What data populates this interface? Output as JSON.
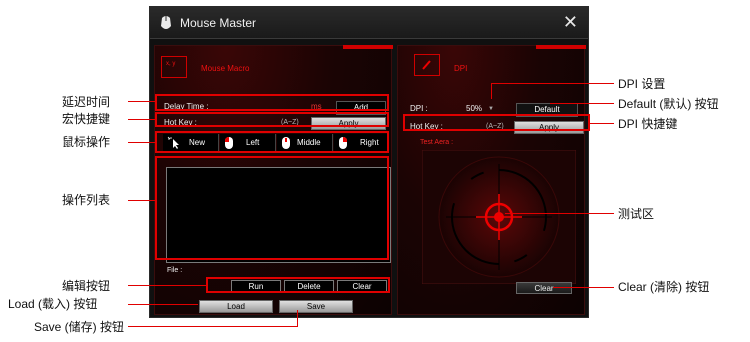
{
  "window": {
    "title": "Mouse Master",
    "close_glyph": "✕"
  },
  "macro": {
    "header_icon_text": "x, y",
    "header": "Mouse Macro",
    "delay_label": "Delay Time :",
    "delay_unit": "ms",
    "add_label": "Add",
    "hotkey_label": "Hot Key :",
    "hotkey_range": "(A~Z)",
    "apply_label": "Apply",
    "actions": [
      {
        "label": "New",
        "icon": "cursor-icon"
      },
      {
        "label": "Left",
        "icon": "mouse-left-icon"
      },
      {
        "label": "Middle",
        "icon": "mouse-middle-icon"
      },
      {
        "label": "Right",
        "icon": "mouse-right-icon"
      }
    ],
    "file_label": "File :",
    "run_label": "Run",
    "delete_label": "Delete",
    "clear_label": "Clear",
    "load_label": "Load",
    "save_label": "Save"
  },
  "dpi": {
    "header": "DPI",
    "dpi_label": "DPI :",
    "dpi_value": "50%",
    "default_label": "Default",
    "hotkey_label": "Hot Key :",
    "hotkey_range": "(A~Z)",
    "apply_label": "Apply",
    "test_area_label": "Test Aera :",
    "clear_label": "Clear"
  },
  "annotations": {
    "delay_time": "延迟时间",
    "macro_hotkey": "宏快捷键",
    "mouse_action": "鼠标操作",
    "action_list": "操作列表",
    "edit_buttons": "编辑按钮",
    "load_button": "Load (载入) 按钮",
    "save_button": "Save (储存) 按钮",
    "dpi_setting": "DPI 设置",
    "default_button": "Default (默认) 按钮",
    "dpi_hotkey": "DPI 快捷键",
    "test_area": "测试区",
    "clear_button": "Clear (清除) 按钮"
  },
  "colors": {
    "accent_red": "#e00000",
    "window_bg": "#101010",
    "panel_red": "#3a0606"
  }
}
